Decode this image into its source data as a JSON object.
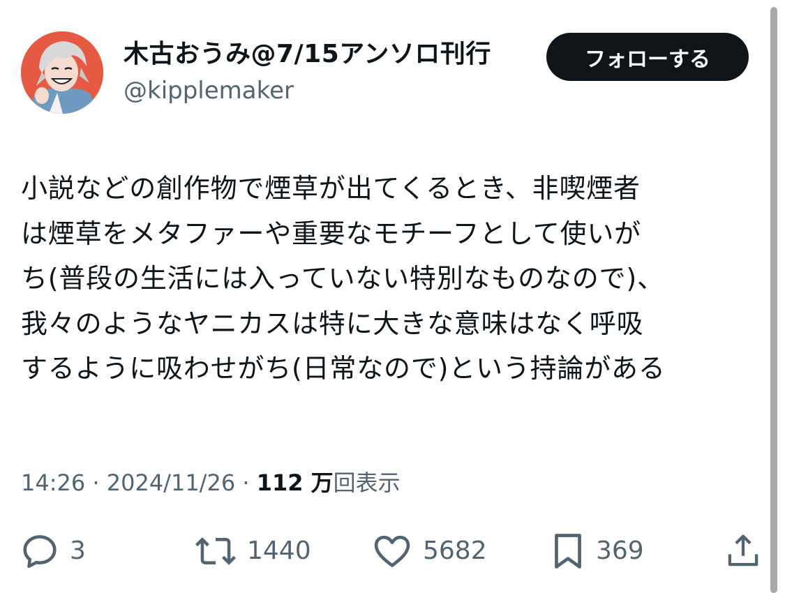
{
  "user": {
    "display_name": "木古おうみ@7/15アンソロ刊行",
    "handle": "@kipplemaker"
  },
  "follow_button": {
    "label": "フォローする"
  },
  "tweet": {
    "lines": [
      "小説などの創作物で煙草が出てくるとき、非喫煙者",
      "は煙草をメタファーや重要なモチーフとして使いが",
      "ち(普段の生活には入っていない特別なものなので)、",
      "我々のようなヤニカスは特に大きな意味はなく呼吸",
      "するように吸わせがち(日常なので)という持論がある"
    ]
  },
  "meta": {
    "time": "14:26",
    "separator": " · ",
    "date": "2024/11/26",
    "views_count": "112 万",
    "views_label": "回表示"
  },
  "actions": {
    "reply": {
      "icon": "reply-icon",
      "count": "3"
    },
    "retweet": {
      "icon": "retweet-icon",
      "count": "1440"
    },
    "like": {
      "icon": "heart-icon",
      "count": "5682"
    },
    "bookmark": {
      "icon": "bookmark-icon",
      "count": "369"
    },
    "share": {
      "icon": "share-icon"
    }
  },
  "colors": {
    "text": "#0f1419",
    "secondary": "#536471",
    "follow_bg": "#0f1419",
    "avatar_bg": "#e65a44"
  }
}
